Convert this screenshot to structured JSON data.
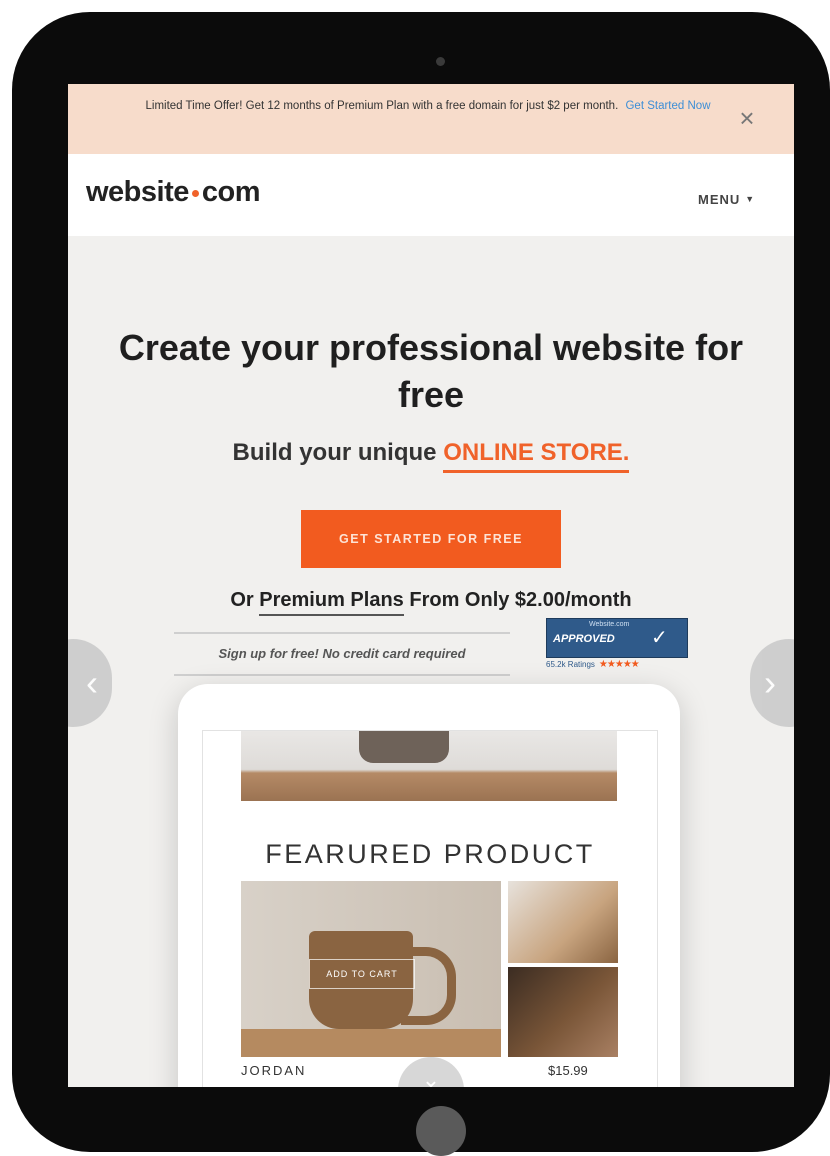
{
  "promo": {
    "text": "Limited Time Offer! Get 12 months of Premium Plan with a free domain for just $2 per month.",
    "link": "Get Started Now",
    "close_icon": "close-icon"
  },
  "nav": {
    "logo_left": "website",
    "logo_right": "com",
    "menu_label": "MENU",
    "menu_icon": "caret-down-icon"
  },
  "hero": {
    "headline": "Create your professional website for free",
    "subhead_prefix": "Build your unique",
    "subhead_accent": "ONLINE STORE.",
    "cta": "GET STARTED FOR FREE",
    "premium_prefix": "Or",
    "premium_link": "Premium Plans",
    "premium_suffix": "From Only $2.00/month",
    "signup_note": "Sign up for free! No credit card required"
  },
  "badge": {
    "top": "Website.com",
    "main": "APPROVED",
    "ratings": "65.2k Ratings",
    "stars": "★★★★★"
  },
  "mockup": {
    "featured_title": "FEARURED PRODUCT",
    "add_to_cart": "ADD TO CART",
    "product_name": "JORDAN",
    "product_price": "$15.99"
  },
  "controls": {
    "prev_icon": "chevron-left-icon",
    "next_icon": "chevron-right-icon",
    "scroll_icon": "chevron-down-icon"
  },
  "colors": {
    "accent": "#f25b1f",
    "promo_bg": "#f7dccb",
    "link": "#3d8ed6",
    "badge": "#2f5a8a"
  }
}
